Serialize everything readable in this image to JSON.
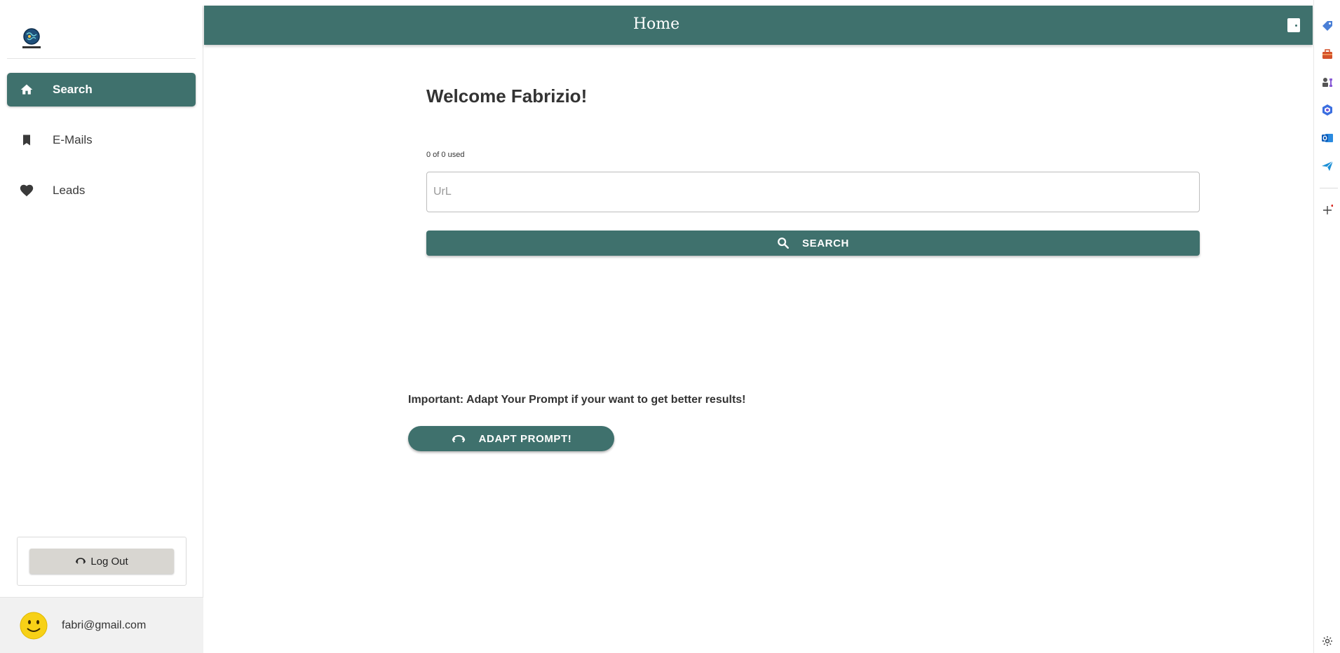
{
  "app": {
    "header_title": "Home"
  },
  "sidebar": {
    "logo_icon": "world-logo-icon",
    "items": [
      {
        "label": "Search",
        "icon": "home-icon",
        "active": true
      },
      {
        "label": "E-Mails",
        "icon": "bookmark-icon",
        "active": false
      },
      {
        "label": "Leads",
        "icon": "heart-icon",
        "active": false
      }
    ],
    "logout_label": "Log Out",
    "user_email": "fabri@gmail.com"
  },
  "main": {
    "welcome": "Welcome Fabrizio!",
    "usage": "0 of 0 used",
    "url_placeholder": "UrL",
    "url_value": "",
    "search_label": "SEARCH",
    "important_text": "Important: Adapt Your Prompt if your want to get better results!",
    "adapt_label": "ADAPT PROMPT!"
  },
  "colors": {
    "accent": "#3f716d",
    "logout_button": "#d8d6d1",
    "user_area": "#f1f1f1"
  },
  "browser_rail": {
    "icons": [
      "tag-icon",
      "toolbox-icon",
      "chess-icon",
      "m365-icon",
      "outlook-icon",
      "send-icon",
      "add-icon",
      "settings-icon"
    ]
  }
}
